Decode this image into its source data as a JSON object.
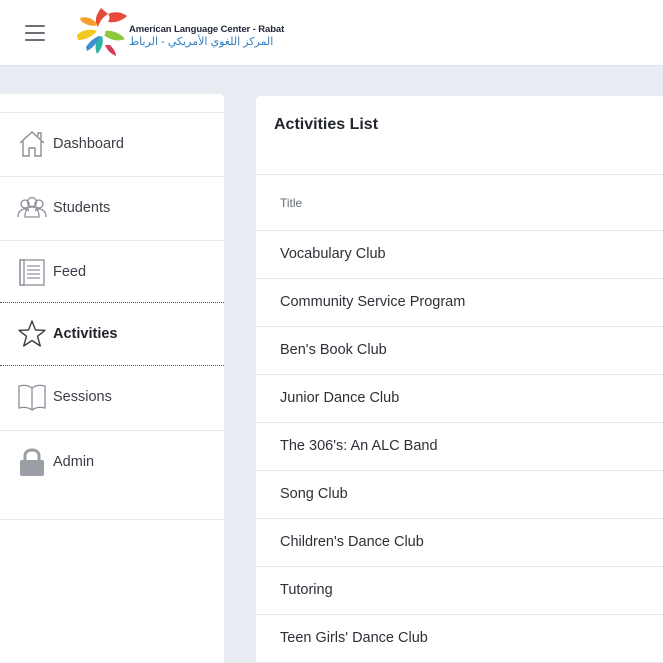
{
  "header": {
    "menu_icon": "hamburger-icon",
    "logo_icon": "star-logo-icon",
    "logo_text_en": "American Language Center - Rabat",
    "logo_text_ar": "المركز اللغوي الأمريكي - الرباط",
    "colors": {
      "logo_en": "#23283b",
      "logo_ar": "#2f7fc3"
    }
  },
  "sidebar": {
    "items": [
      {
        "label": "Dashboard",
        "icon": "house-icon",
        "active": false
      },
      {
        "label": "Students",
        "icon": "people-icon",
        "active": false
      },
      {
        "label": "Feed",
        "icon": "document-icon",
        "active": false
      },
      {
        "label": "Activities",
        "icon": "star-icon",
        "active": true
      },
      {
        "label": "Sessions",
        "icon": "book-icon",
        "active": false
      },
      {
        "label": "Admin",
        "icon": "lock-icon",
        "active": false
      }
    ]
  },
  "main": {
    "title": "Activities List",
    "table": {
      "columns": [
        "Title"
      ],
      "rows": [
        "Vocabulary Club",
        "Community Service Program",
        "Ben's Book Club",
        "Junior Dance Club",
        "The 306's: An ALC Band",
        "Song Club",
        "Children's Dance Club",
        "Tutoring",
        "Teen Girls' Dance Club"
      ]
    }
  },
  "colors": {
    "page_background": "#e9edf3",
    "panel": "#ffffff",
    "divider": "#e3e7ec"
  }
}
